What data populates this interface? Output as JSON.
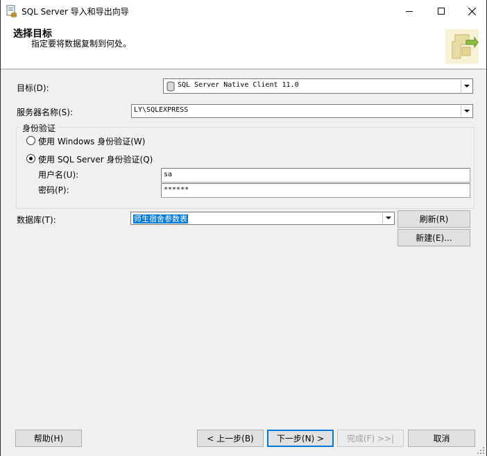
{
  "window": {
    "title": "SQL Server 导入和导出向导"
  },
  "header": {
    "title": "选择目标",
    "subtitle": "指定要将数据复制到何处。",
    "art_icon": "wizard-destination-icon"
  },
  "form": {
    "destination": {
      "label": "目标(D):",
      "value": "SQL Server Native Client 11.0"
    },
    "server": {
      "label": "服务器名称(S):",
      "value": "LY\\SQLEXPRESS"
    },
    "auth": {
      "group_label": "身份验证",
      "windows_label": "使用 Windows 身份验证(W)",
      "sql_label": "使用 SQL Server 身份验证(Q)",
      "selected": "sql",
      "username_label": "用户名(U):",
      "username_value": "sa",
      "password_label": "密码(P):",
      "password_value": "******"
    },
    "database": {
      "label": "数据库(T):",
      "value": "师生宿舍参数表"
    },
    "refresh_label": "刷新(R)",
    "new_label": "新建(E)..."
  },
  "footer": {
    "help_label": "帮助(H)",
    "back_label": "< 上一步(B)",
    "next_label": "下一步(N) >",
    "finish_label": "完成(F) >>|",
    "cancel_label": "取消"
  },
  "colors": {
    "accent": "#0078d7",
    "background": "#f0f0f0"
  }
}
